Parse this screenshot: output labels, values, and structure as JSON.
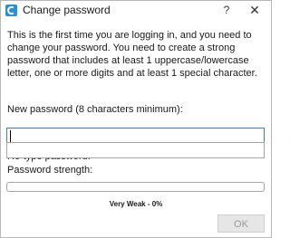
{
  "window": {
    "title": "Change password",
    "help_label": "?",
    "close_label": "✕",
    "app_icon": "app-logo-icon",
    "accent_color": "#2b8fd3"
  },
  "intro_text": "This is the first time you are logging in, and you need to change your password. You need to create a strong password that includes at least 1 uppercase/lowercase letter, one or more digits and at least 1 special character.",
  "new_password": {
    "label": "New password (8 characters minimum):",
    "value": "",
    "focused": true
  },
  "retype_password": {
    "label": "Re-type password:",
    "value": ""
  },
  "strength": {
    "label": "Password strength:",
    "status_text": "Very Weak - 0%",
    "percent": 0
  },
  "buttons": {
    "ok_label": "OK",
    "ok_enabled": false
  }
}
